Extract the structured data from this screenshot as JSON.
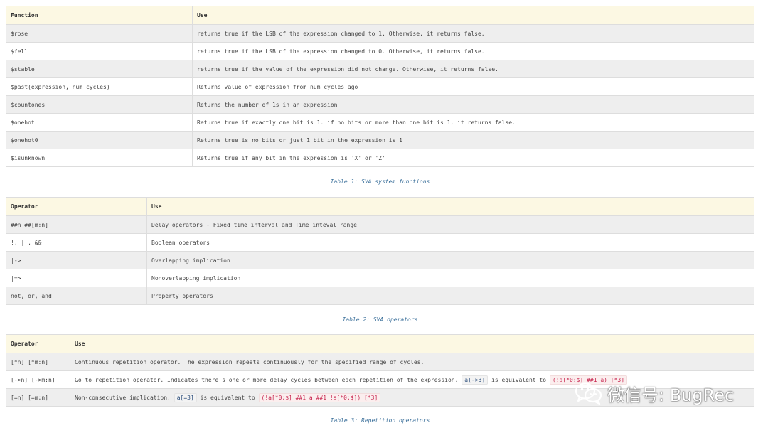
{
  "table1": {
    "headers": [
      "Function",
      "Use"
    ],
    "rows": [
      [
        "$rose",
        "returns true if the LSB of the expression changed to 1. Otherwise, it returns false."
      ],
      [
        "$fell",
        "returns true if the LSB of the expression changed to 0. Otherwise, it returns false."
      ],
      [
        "$stable",
        "returns true if the value of the expression did not change. Otherwise, it returns false."
      ],
      [
        "$past(expression, num_cycles)",
        "Returns value of expression from num_cycles ago"
      ],
      [
        "$countones",
        "Returns the number of 1s in an expression"
      ],
      [
        "$onehot",
        "Returns true if exactly one bit is 1. if no bits or more than one bit is 1, it returns false."
      ],
      [
        "$onehot0",
        "Returns true is no bits or just 1 bit in the expression is 1"
      ],
      [
        "$isunknown",
        "Returns true if any bit in the expression is 'X' or 'Z'"
      ]
    ],
    "caption": "Table 1: SVA system functions"
  },
  "table2": {
    "headers": [
      "Operator",
      "Use"
    ],
    "rows": [
      [
        "##n ##[m:n]",
        "Delay operators - Fixed time interval and Time inteval range"
      ],
      [
        "!, ||, &&",
        "Boolean operators"
      ],
      [
        "|->",
        "Overlapping implication"
      ],
      [
        "|=>",
        "Nonoverlapping implication"
      ],
      [
        "not, or, and",
        "Property operators"
      ]
    ],
    "caption": "Table 2: SVA operators"
  },
  "table3": {
    "headers": [
      "Operator",
      "Use"
    ],
    "rows": [
      {
        "op": "[*n] [*m:n]",
        "text": "Continuous repetition operator. The expression repeats continuously for the specified range of cycles."
      },
      {
        "op": "[->n] [->m:n]",
        "text": "Go to repetition operator. Indicates there's one or more delay cycles between each repetition of the expression.",
        "code1": "a[->3]",
        "mid": "is equivalent to",
        "code2": "(!a[*0:$] ##1 a) [*3]"
      },
      {
        "op": "[=n] [=m:n]",
        "text": "Non-consecutive implication.",
        "code1": "a[=3]",
        "mid": "is equivalent to",
        "code2": "(!a[*0:$] ##1 a ##1 !a[*0:$]) [*3]"
      }
    ],
    "caption": "Table 3: Repetition operators"
  },
  "watermark": {
    "icon": "wechat-icon",
    "text": "微信号: BugRec"
  }
}
